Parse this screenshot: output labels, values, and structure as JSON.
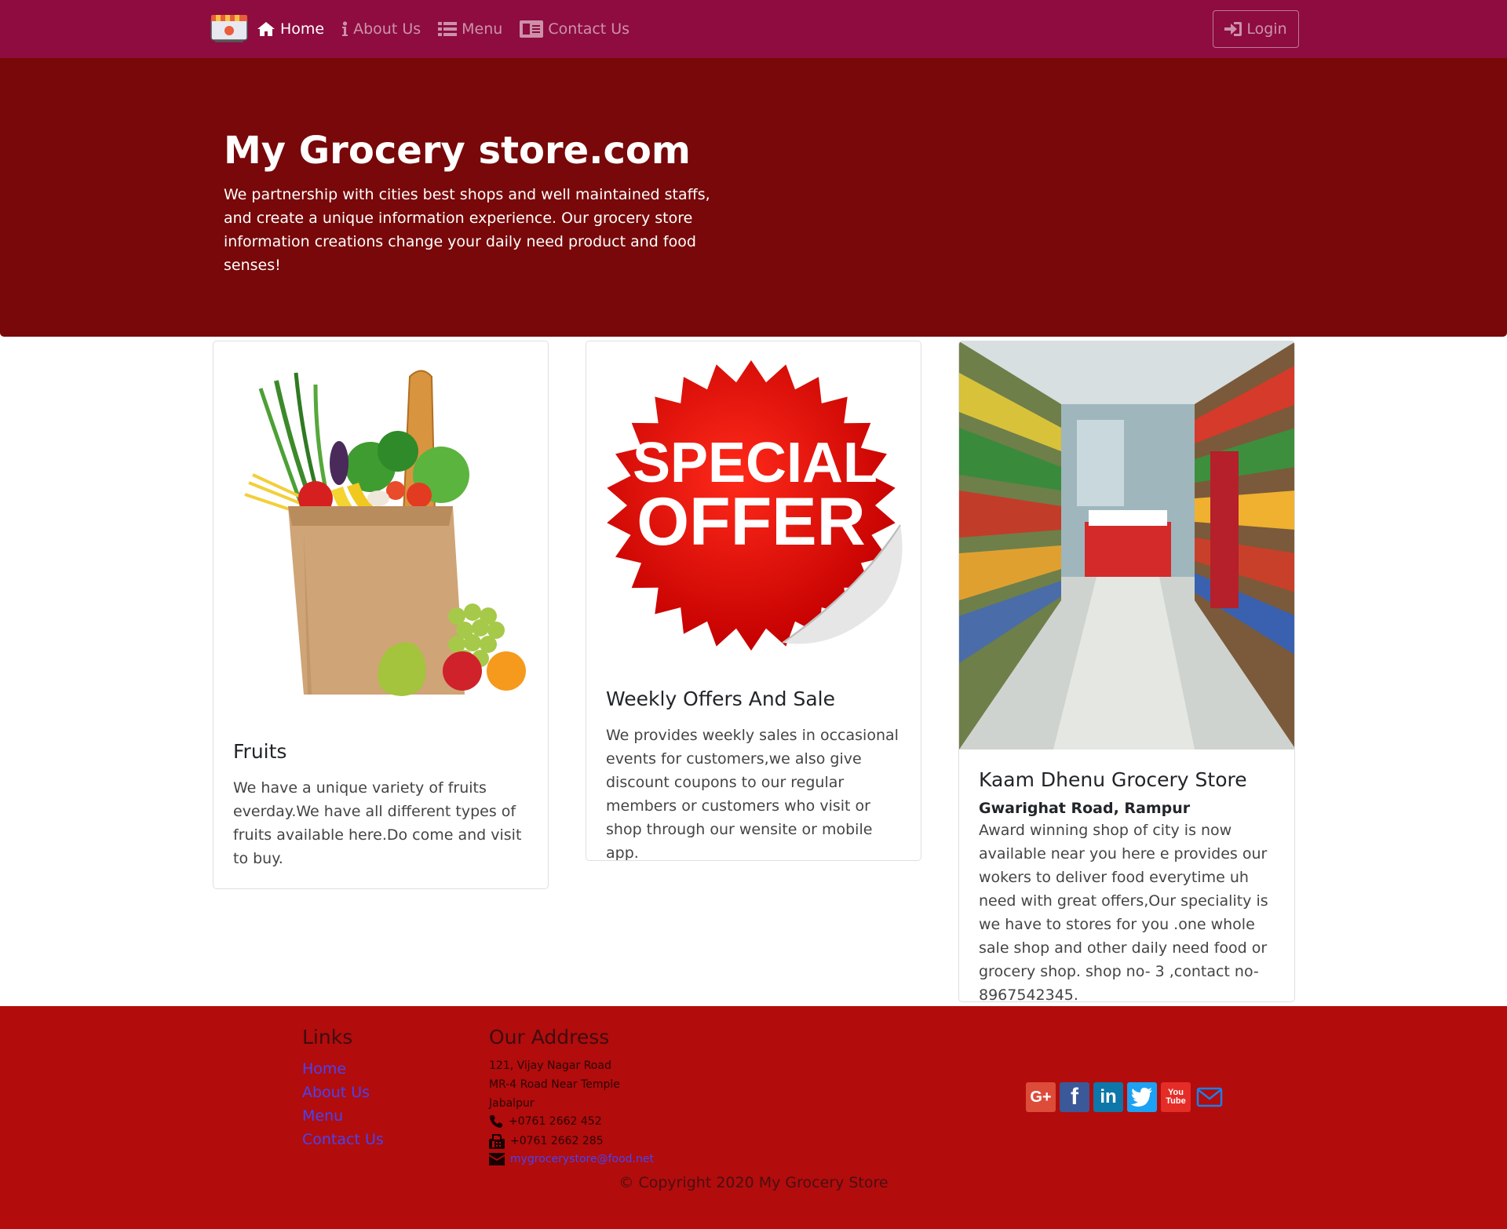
{
  "navbar": {
    "logo_icon": "store-logo-icon",
    "links": [
      {
        "label": "Home",
        "icon": "home-icon",
        "active": true
      },
      {
        "label": "About Us",
        "icon": "info-icon",
        "active": false
      },
      {
        "label": "Menu",
        "icon": "list-icon",
        "active": false
      },
      {
        "label": "Contact Us",
        "icon": "address-card-icon",
        "active": false
      }
    ],
    "login": {
      "label": "Login",
      "icon": "sign-in-icon"
    }
  },
  "hero": {
    "title": "My Grocery store.com",
    "text": "We partnership with cities best shops and well maintained staffs, and create a unique information experience. Our grocery store information creations change your daily need product and food senses!"
  },
  "cards": [
    {
      "image": "grocery-bag-image",
      "title": "Fruits",
      "text": "We have a unique variety of fruits everday.We have all different types of fruits available here.Do come and visit to buy."
    },
    {
      "image": "special-offer-sticker-image",
      "image_text": [
        "SPECIAL",
        "OFFER"
      ],
      "title": "Weekly Offers And Sale",
      "text": "We provides weekly sales in occasional events for customers,we also give discount coupons to our regular members or customers who visit or shop through our wensite or mobile app."
    },
    {
      "image": "store-aisle-image",
      "title": "Kaam Dhenu Grocery Store",
      "subtitle": "Gwarighat Road, Rampur",
      "text": "Award winning shop of city is now available near you here e provides our wokers to deliver food everytime uh need with great offers,Our speciality is we have to stores for you .one whole sale shop and other daily need food or grocery shop. shop no- 3 ,contact no-8967542345."
    }
  ],
  "footer": {
    "links_heading": "Links",
    "links": [
      "Home",
      "About Us",
      "Menu",
      "Contact Us"
    ],
    "address_heading": "Our Address",
    "address": [
      "121, Vijay Nagar Road",
      "MR-4 Road Near Temple",
      "Jabalpur"
    ],
    "phone": "+0761 2662 452",
    "fax": "+0761 2662 285",
    "email": "mygrocerystore@food.net",
    "social": [
      {
        "name": "google-plus",
        "glyph": "G+",
        "color": "#dd4b39"
      },
      {
        "name": "facebook",
        "glyph": "f",
        "color": "#3b5998"
      },
      {
        "name": "linkedin",
        "glyph": "in",
        "color": "#0e76a8"
      },
      {
        "name": "twitter",
        "glyph": "🐦",
        "color": "#1da1f2"
      },
      {
        "name": "youtube",
        "glyph": "You Tube",
        "color": "#e52d27"
      },
      {
        "name": "mail",
        "glyph": "✉",
        "color": "transparent"
      }
    ],
    "copyright": "© Copyright 2020 My Grocery Store"
  },
  "colors": {
    "navbar": "#8e0c40",
    "jumbotron": "#780809",
    "footer": "#b20c0c",
    "link": "#4545f5"
  }
}
